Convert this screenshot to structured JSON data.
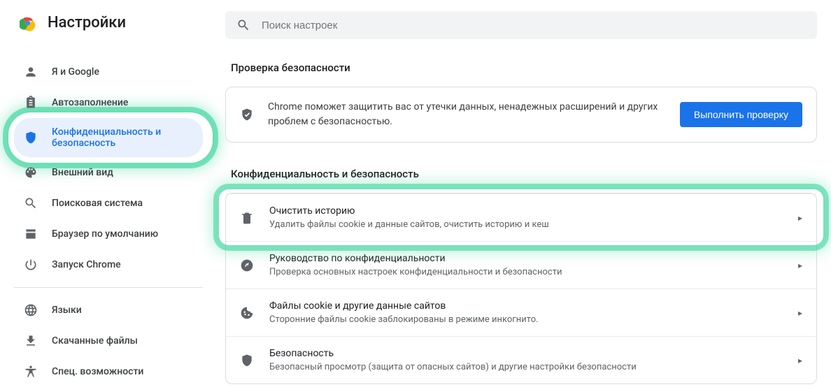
{
  "page_title": "Настройки",
  "search": {
    "placeholder": "Поиск настроек"
  },
  "sidebar": {
    "items": [
      {
        "label": "Я и Google"
      },
      {
        "label": "Автозаполнение"
      },
      {
        "label": "Конфиденциальность и безопасность"
      },
      {
        "label": "Внешний вид"
      },
      {
        "label": "Поисковая система"
      },
      {
        "label": "Браузер по умолчанию"
      },
      {
        "label": "Запуск Chrome"
      },
      {
        "label": "Языки"
      },
      {
        "label": "Скачанные файлы"
      },
      {
        "label": "Спец. возможности"
      }
    ]
  },
  "safety": {
    "heading": "Проверка безопасности",
    "text": "Chrome поможет защитить вас от утечки данных, ненадежных расширений и других проблем с безопасностью.",
    "button": "Выполнить проверку"
  },
  "privacy": {
    "heading": "Конфиденциальность и безопасность",
    "rows": [
      {
        "title": "Очистить историю",
        "sub": "Удалить файлы cookie и данные сайтов, очистить историю и кеш"
      },
      {
        "title": "Руководство по конфиденциальности",
        "sub": "Проверка основных настроек конфиденциальности и безопасности"
      },
      {
        "title": "Файлы cookie и другие данные сайтов",
        "sub": "Сторонние файлы cookie заблокированы в режиме инкогнито."
      },
      {
        "title": "Безопасность",
        "sub": "Безопасный просмотр (защита от опасных сайтов) и другие настройки безопасности"
      }
    ]
  }
}
